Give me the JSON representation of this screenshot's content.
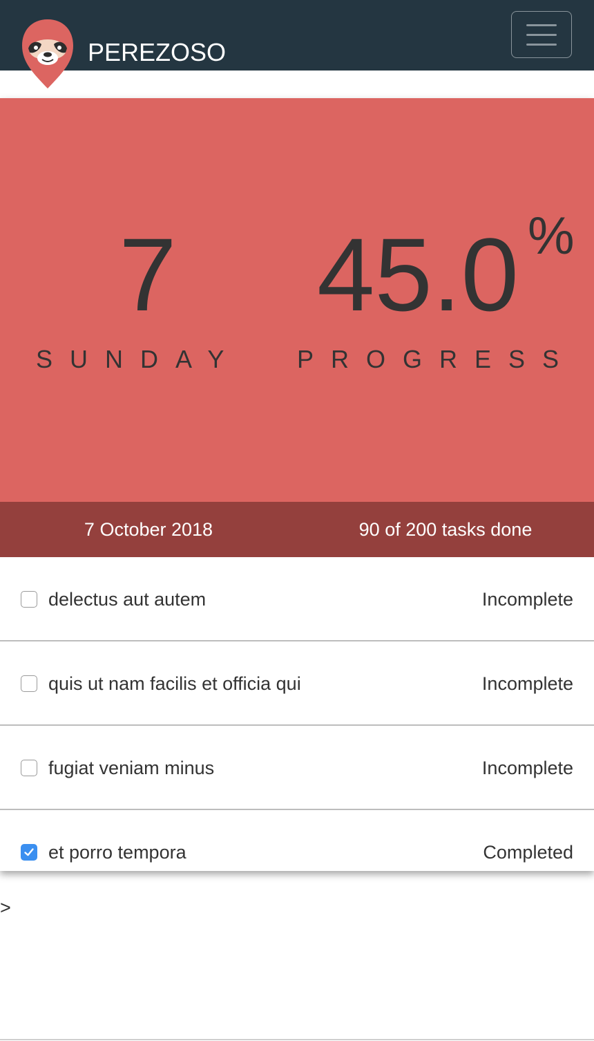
{
  "app": {
    "brand": "PEREZOSO",
    "logo_icon": "sloth-logo-icon",
    "menu_icon": "hamburger-menu-icon"
  },
  "stats": {
    "day_number": "7",
    "day_label": "SUNDAY",
    "progress_value": "45.0",
    "progress_unit": "%",
    "progress_label": "PROGRESS",
    "progress_fraction": 0.45
  },
  "info": {
    "date": "7 October 2018",
    "tasks_done": "90 of 200 tasks done"
  },
  "tasks": [
    {
      "title": "delectus aut autem",
      "status": "Incomplete",
      "checked": false
    },
    {
      "title": "quis ut nam facilis et officia qui",
      "status": "Incomplete",
      "checked": false
    },
    {
      "title": "fugiat veniam minus",
      "status": "Incomplete",
      "checked": false
    },
    {
      "title": "et porro tempora",
      "status": "Completed",
      "checked": true
    }
  ],
  "stray_text": ">",
  "colors": {
    "navbar": "#243641",
    "hero": "#dc6561",
    "info_bar": "#94403d",
    "checkbox_checked": "#3b8ff0",
    "text": "#333333"
  }
}
